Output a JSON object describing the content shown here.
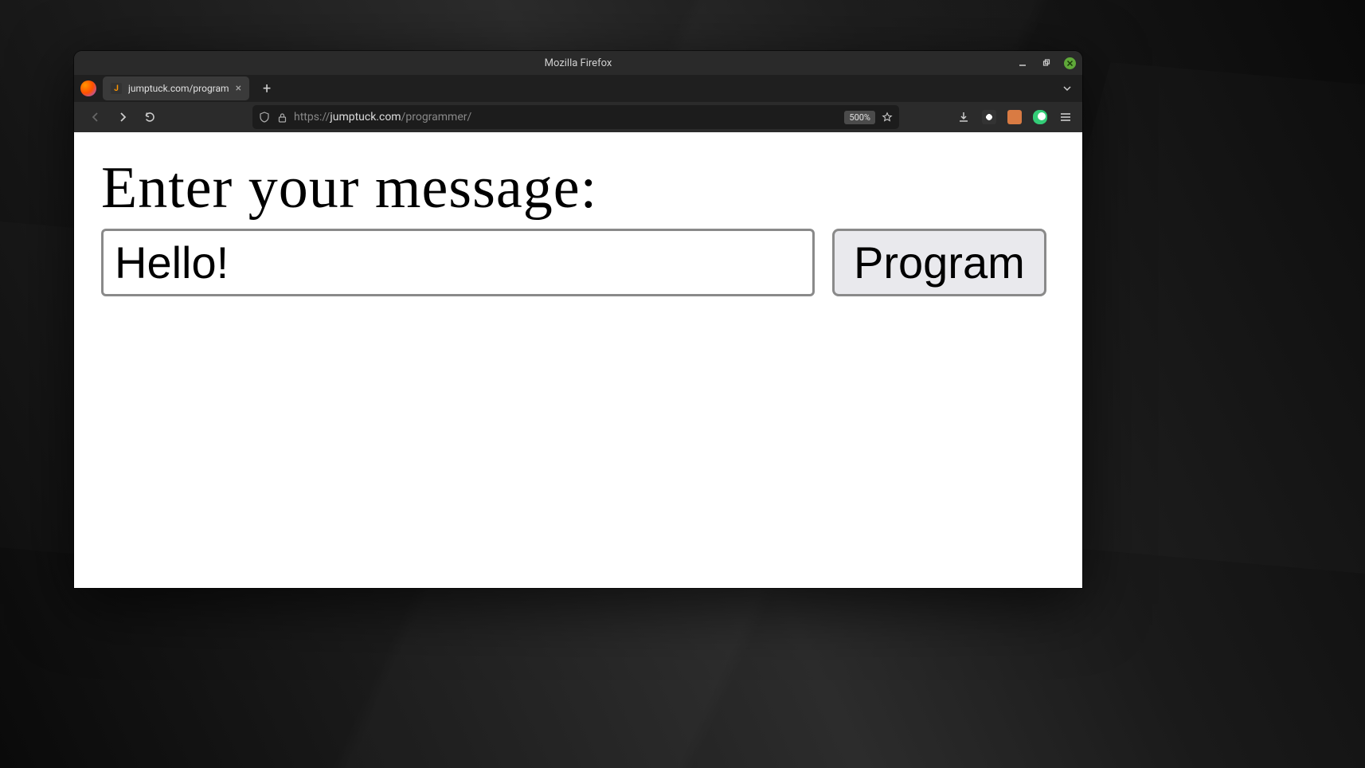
{
  "window": {
    "title": "Mozilla Firefox"
  },
  "tab": {
    "favicon_letter": "J",
    "title": "jumptuck.com/program"
  },
  "urlbar": {
    "protocol": "https://",
    "host": "jumptuck.com",
    "path": "/programmer/",
    "zoom": "500%"
  },
  "page": {
    "heading": "Enter your message:",
    "input_value": "Hello!",
    "button_label": "Program"
  }
}
